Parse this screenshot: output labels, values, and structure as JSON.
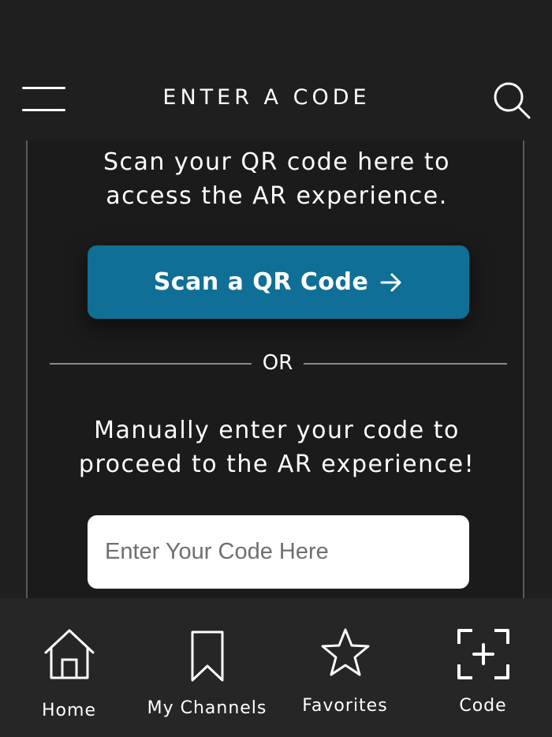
{
  "header": {
    "title": "ENTER A CODE",
    "menu_icon": "hamburger-menu-icon",
    "search_icon": "search-icon"
  },
  "main": {
    "scan_description": "Scan your QR code here to\naccess the AR experience.",
    "scan_button_label": "Scan a QR Code",
    "scan_button_icon": "arrow-right-icon",
    "divider_text": "OR",
    "manual_description": "Manually enter your code to\nproceed to the AR experience!",
    "code_input": {
      "value": "",
      "placeholder": "Enter Your Code Here"
    }
  },
  "tabbar": {
    "tabs": [
      {
        "label": "Home",
        "icon": "home-icon"
      },
      {
        "label": "My Channels",
        "icon": "bookmark-icon"
      },
      {
        "label": "Favorites",
        "icon": "star-icon"
      },
      {
        "label": "Code",
        "icon": "scan-code-icon"
      }
    ]
  },
  "colors": {
    "background": "#1f1f1f",
    "accent": "#0f6f96",
    "tabbar": "#262626"
  }
}
